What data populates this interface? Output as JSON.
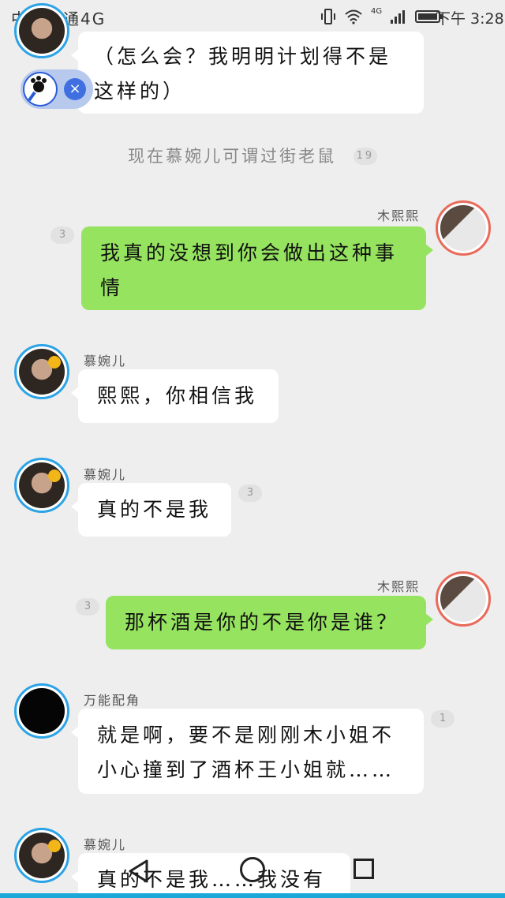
{
  "status_bar": {
    "carrier": "中国联通4G",
    "time": "下午 3:28",
    "network": "4G"
  },
  "floating_tool": {
    "close_symbol": "×"
  },
  "system_message": {
    "text": "现在慕婉儿可谓过街老鼠",
    "badge": "19"
  },
  "messages": [
    {
      "side": "left",
      "sender": "",
      "text_lines": [
        "（怎么会？我明明计划得不是",
        "这样的）"
      ],
      "avatar": "girl-flower-avatar"
    },
    {
      "side": "right",
      "sender": "木熙熙",
      "text_lines": [
        "我真的没想到你会做出这种事",
        "情"
      ],
      "badge": "3",
      "avatar": "girl-white-avatar"
    },
    {
      "side": "left",
      "sender": "慕婉儿",
      "text_lines": [
        "熙熙，你相信我"
      ],
      "avatar": "girl-flower-avatar"
    },
    {
      "side": "left",
      "sender": "慕婉儿",
      "text_lines": [
        "真的不是我"
      ],
      "badge": "3",
      "avatar": "girl-flower-avatar"
    },
    {
      "side": "right",
      "sender": "木熙熙",
      "text_lines": [
        "那杯酒是你的不是你是谁？"
      ],
      "badge": "3",
      "avatar": "girl-white-avatar"
    },
    {
      "side": "left",
      "sender": "万能配角",
      "text_lines": [
        "就是啊，要不是刚刚木小姐不",
        "小心撞到了酒杯王小姐就……"
      ],
      "badge": "1",
      "avatar": "black-text-avatar"
    },
    {
      "side": "left",
      "sender": "慕婉儿",
      "text_lines": [
        "真的不是我……我没有"
      ],
      "avatar": "girl-flower-avatar"
    }
  ],
  "colors": {
    "background": "#eeeeee",
    "green_bubble": "#95e35f",
    "left_avatar_ring": "#2ba3e6",
    "right_avatar_ring": "#ea6a5a"
  },
  "nav_bar": {
    "icons": [
      "back-triangle-icon",
      "home-circle-icon",
      "recent-square-icon"
    ]
  }
}
